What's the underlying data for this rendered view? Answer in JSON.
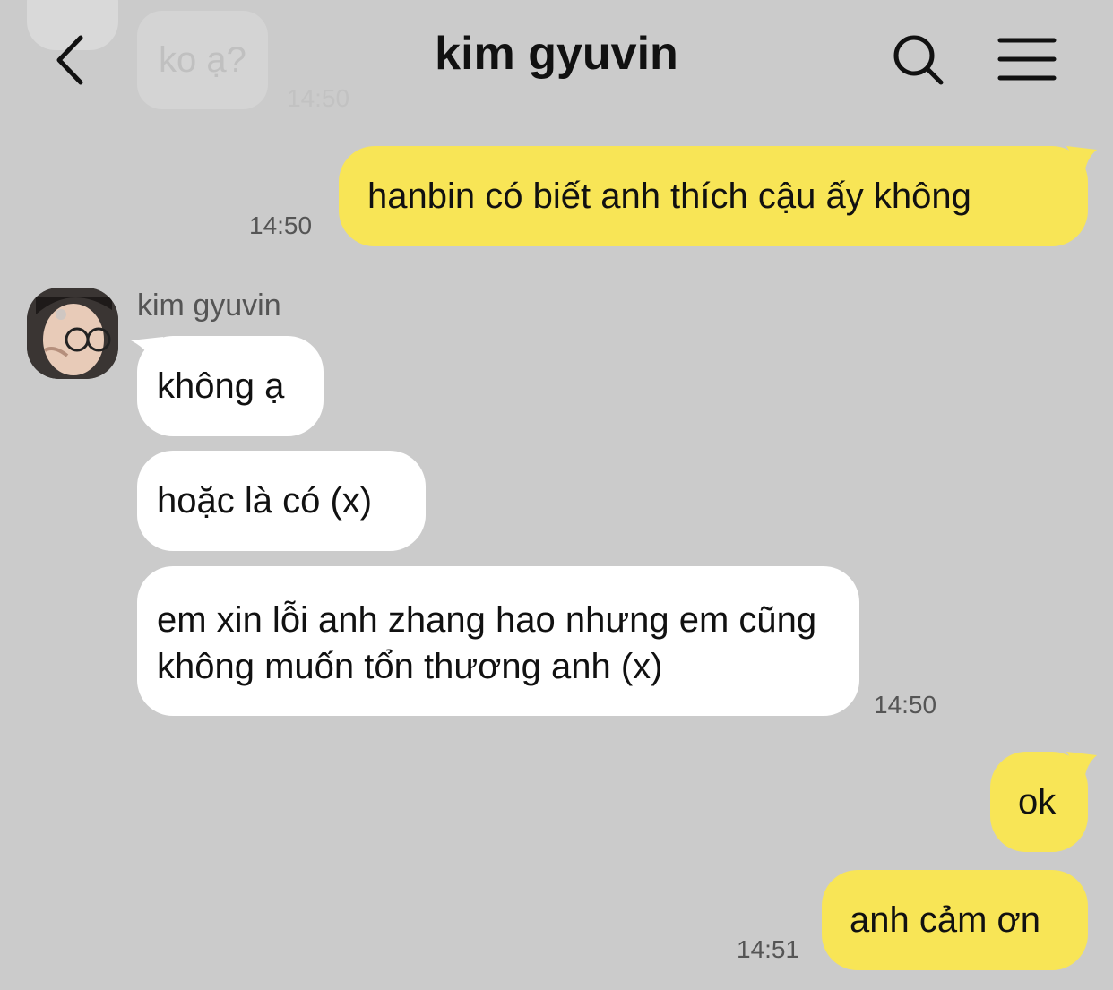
{
  "header": {
    "title": "kim gyuvin",
    "back_icon": "chevron-left-icon",
    "search_icon": "search-icon",
    "menu_icon": "menu-icon"
  },
  "colors": {
    "background": "#cbcbcb",
    "sent_bubble": "#f8e556",
    "received_bubble": "#ffffff"
  },
  "previous_message": {
    "text": "ko ạ?",
    "time": "14:50"
  },
  "messages": [
    {
      "direction": "sent",
      "text": "hanbin có biết anh thích cậu ấy không",
      "time": "14:50"
    },
    {
      "direction": "received",
      "sender": "kim gyuvin",
      "text": "không ạ"
    },
    {
      "direction": "received",
      "text": "hoặc là có (x)"
    },
    {
      "direction": "received",
      "text": "em xin lỗi anh zhang hao nhưng em cũng không muốn tổn thương anh (x)",
      "time": "14:50"
    },
    {
      "direction": "sent",
      "text": "ok"
    },
    {
      "direction": "sent",
      "text": "anh cảm ơn",
      "time": "14:51"
    }
  ]
}
